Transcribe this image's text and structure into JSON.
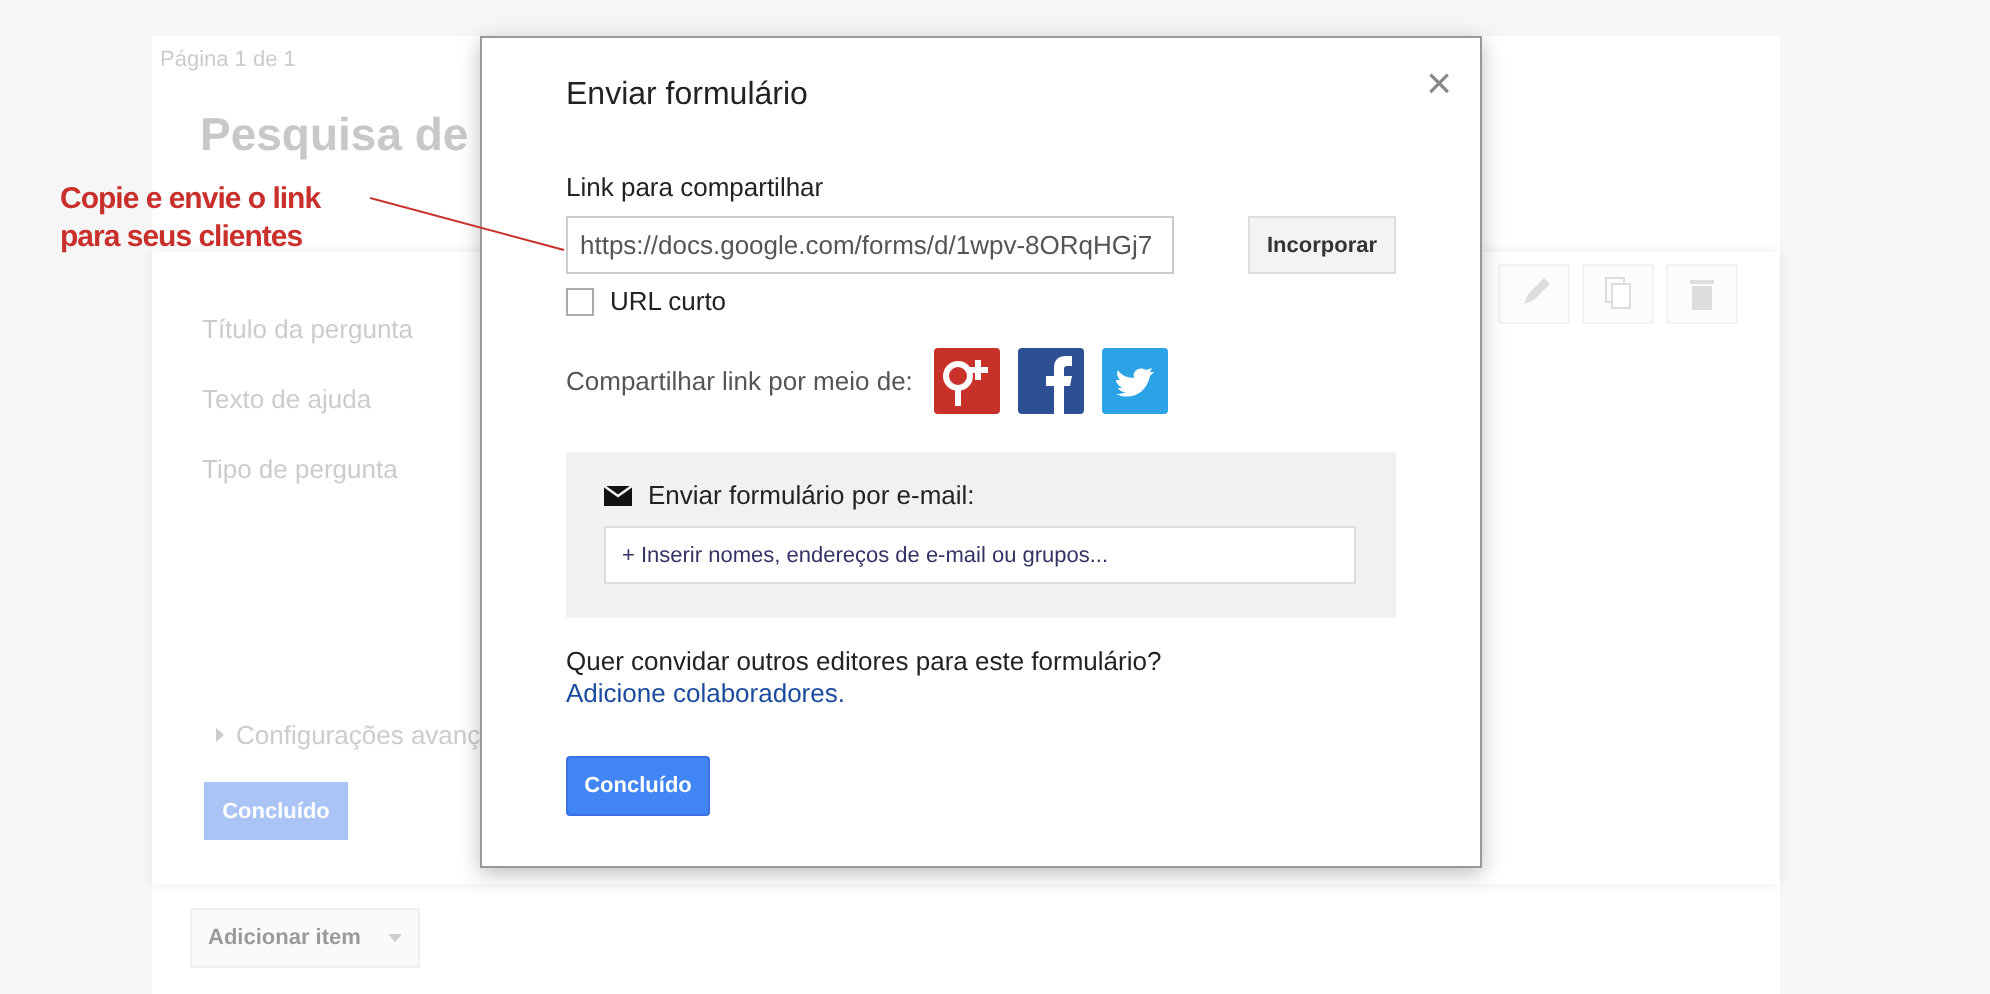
{
  "background_form": {
    "page_label": "Página 1 de 1",
    "title": "Pesquisa de",
    "fields": [
      "Título da pergunta",
      "Texto de ajuda",
      "Tipo de pergunta"
    ],
    "advanced": "Configurações avanç",
    "done_button": "Concluído",
    "add_item_button": "Adicionar item"
  },
  "annotation": {
    "text": "Copie e envie o link para seus clientes"
  },
  "dialog": {
    "title": "Enviar formulário",
    "close": "×",
    "link_label": "Link para compartilhar",
    "link_value": "https://docs.google.com/forms/d/1wpv-8ORqHGj7",
    "embed_button": "Incorporar",
    "short_url": {
      "label": "URL curto",
      "checked": false
    },
    "share_label": "Compartilhar link por meio de:",
    "share_services": [
      {
        "kind": "googleplus"
      },
      {
        "kind": "facebook"
      },
      {
        "kind": "twitter"
      }
    ],
    "email_label": "Enviar formulário por e-mail:",
    "email_placeholder": "+ Inserir nomes, endereços de e-mail ou grupos...",
    "invite_text": "Quer convidar outros editores para este formulário?",
    "invite_link": "Adicione colaboradores.",
    "done_button": "Concluído"
  }
}
